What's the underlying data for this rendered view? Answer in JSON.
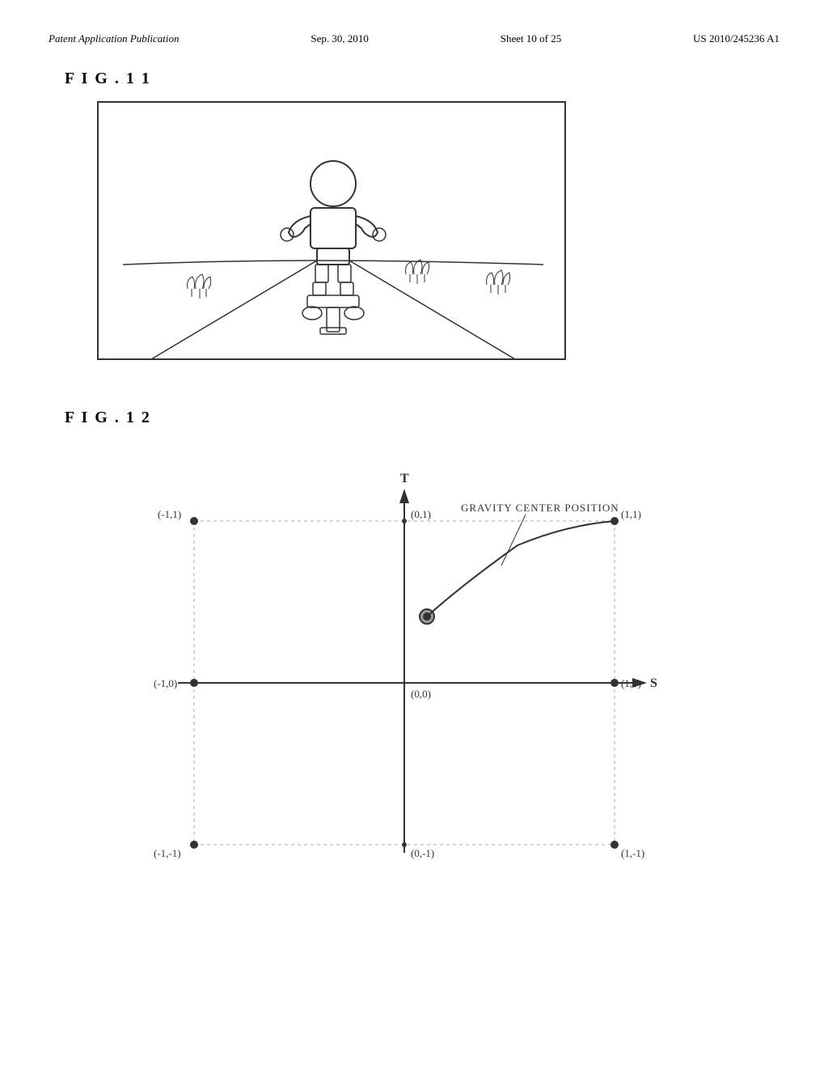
{
  "header": {
    "left": "Patent Application Publication",
    "center": "Sep. 30, 2010",
    "sheet": "Sheet 10 of 25",
    "right": "US 2010/245236 A1"
  },
  "fig11": {
    "label": "F I G .  1 1"
  },
  "fig12": {
    "label": "F I G .  1 2",
    "title": "GRAVITY CENTER POSITION",
    "axis_s": "S",
    "axis_t": "T",
    "points": {
      "top_left": "(-1,1)",
      "top_center": "(0,1)",
      "top_right": "(1,1)",
      "mid_left": "(-1,0)",
      "mid_center": "(0,0)",
      "mid_right": "(1,0)",
      "bot_left": "(-1,-1)",
      "bot_center": "(0,-1)",
      "bot_right": "(1,-1)"
    }
  }
}
